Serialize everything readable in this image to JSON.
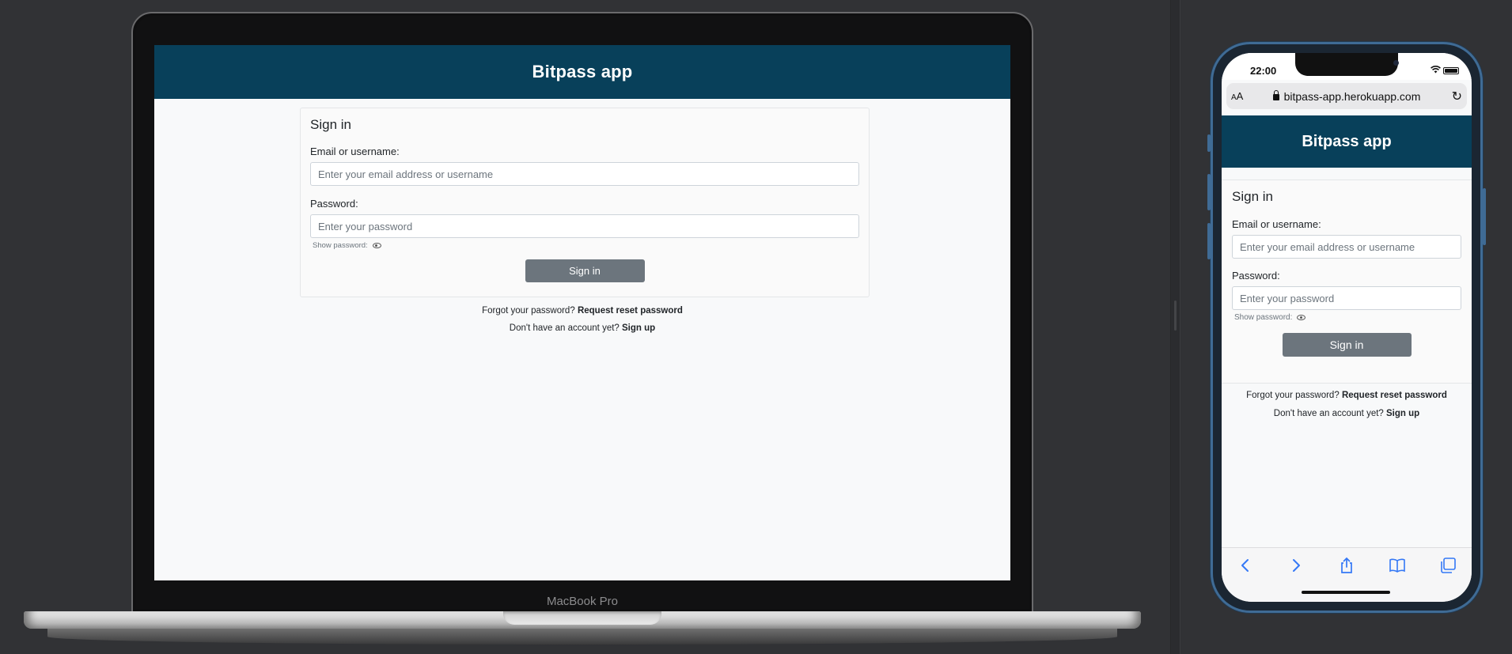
{
  "app": {
    "title": "Bitpass app",
    "signin_heading": "Sign in",
    "email_label": "Email or username:",
    "email_placeholder": "Enter your email address or username",
    "password_label": "Password:",
    "password_placeholder": "Enter your password",
    "show_password_label": "Show password:",
    "signin_button": "Sign in",
    "forgot_text": "Forgot your password?",
    "forgot_link": "Request reset password",
    "no_account_text": "Don't have an account yet?",
    "signup_link": "Sign up"
  },
  "macbook": {
    "model_label": "MacBook Pro"
  },
  "iphone": {
    "time": "22:00",
    "url_text_size": "AA",
    "url": "bitpass-app.herokuapp.com",
    "toolbar": [
      "back-icon",
      "forward-icon",
      "share-icon",
      "bookmarks-icon",
      "tabs-icon"
    ]
  },
  "colors": {
    "header_bg": "#08405a",
    "button_bg": "#6c757d",
    "page_bg": "#f8f9fa",
    "safari_accent": "#3478f6",
    "iphone_frame": "#3f6b95"
  }
}
